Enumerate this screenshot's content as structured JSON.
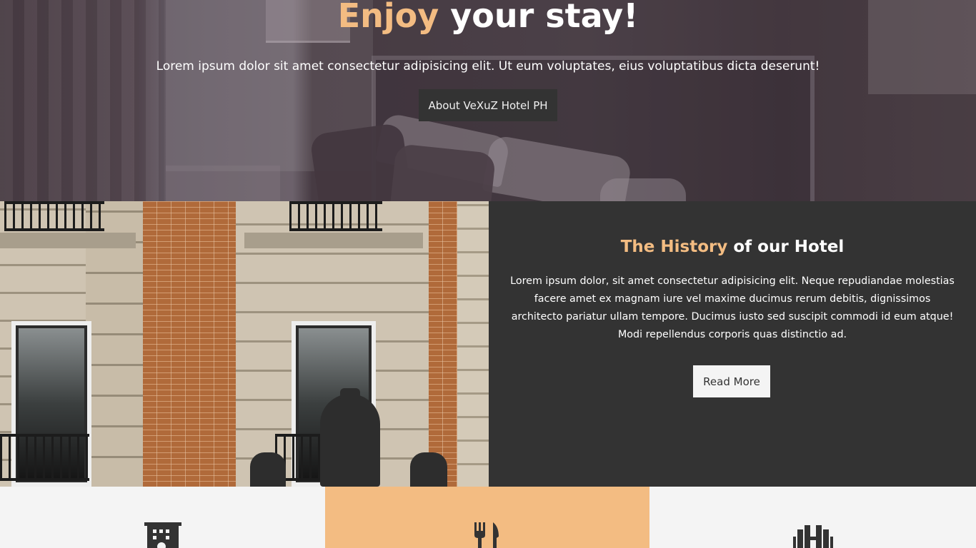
{
  "hero": {
    "title_accent": "Enjoy",
    "title_rest": " your stay!",
    "text": "Lorem ipsum dolor sit amet consectetur adipisicing elit. Ut eum voluptates, eius voluptatibus dicta deserunt!",
    "button_label": "About VeXuZ Hotel PH"
  },
  "history": {
    "title_accent": "The History",
    "title_rest": " of our Hotel",
    "text": "Lorem ipsum dolor, sit amet consectetur adipisicing elit. Neque repudiandae molestias facere amet ex magnam iure vel maxime ducimus rerum debitis, dignissimos architecto pariatur ullam tempore. Ducimus iusto sed suscipit commodi id eum atque! Modi repellendus corporis quas distinctio ad.",
    "button_label": "Read More"
  },
  "features": [
    {
      "icon": "hotel-building-icon"
    },
    {
      "icon": "utensils-icon"
    },
    {
      "icon": "dumbbell-icon"
    }
  ],
  "colors": {
    "accent": "#f3bc82",
    "dark": "#333333",
    "light": "#f4f4f4"
  }
}
